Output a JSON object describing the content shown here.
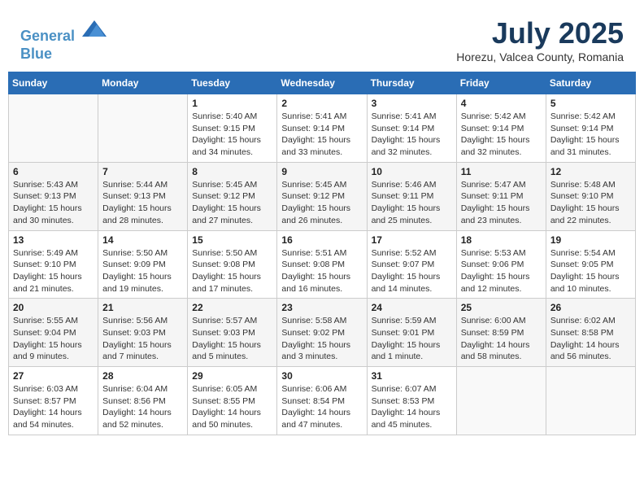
{
  "header": {
    "logo_line1": "General",
    "logo_line2": "Blue",
    "month_year": "July 2025",
    "location": "Horezu, Valcea County, Romania"
  },
  "weekdays": [
    "Sunday",
    "Monday",
    "Tuesday",
    "Wednesday",
    "Thursday",
    "Friday",
    "Saturday"
  ],
  "weeks": [
    [
      {
        "day": "",
        "info": ""
      },
      {
        "day": "",
        "info": ""
      },
      {
        "day": "1",
        "info": "Sunrise: 5:40 AM\nSunset: 9:15 PM\nDaylight: 15 hours\nand 34 minutes."
      },
      {
        "day": "2",
        "info": "Sunrise: 5:41 AM\nSunset: 9:14 PM\nDaylight: 15 hours\nand 33 minutes."
      },
      {
        "day": "3",
        "info": "Sunrise: 5:41 AM\nSunset: 9:14 PM\nDaylight: 15 hours\nand 32 minutes."
      },
      {
        "day": "4",
        "info": "Sunrise: 5:42 AM\nSunset: 9:14 PM\nDaylight: 15 hours\nand 32 minutes."
      },
      {
        "day": "5",
        "info": "Sunrise: 5:42 AM\nSunset: 9:14 PM\nDaylight: 15 hours\nand 31 minutes."
      }
    ],
    [
      {
        "day": "6",
        "info": "Sunrise: 5:43 AM\nSunset: 9:13 PM\nDaylight: 15 hours\nand 30 minutes."
      },
      {
        "day": "7",
        "info": "Sunrise: 5:44 AM\nSunset: 9:13 PM\nDaylight: 15 hours\nand 28 minutes."
      },
      {
        "day": "8",
        "info": "Sunrise: 5:45 AM\nSunset: 9:12 PM\nDaylight: 15 hours\nand 27 minutes."
      },
      {
        "day": "9",
        "info": "Sunrise: 5:45 AM\nSunset: 9:12 PM\nDaylight: 15 hours\nand 26 minutes."
      },
      {
        "day": "10",
        "info": "Sunrise: 5:46 AM\nSunset: 9:11 PM\nDaylight: 15 hours\nand 25 minutes."
      },
      {
        "day": "11",
        "info": "Sunrise: 5:47 AM\nSunset: 9:11 PM\nDaylight: 15 hours\nand 23 minutes."
      },
      {
        "day": "12",
        "info": "Sunrise: 5:48 AM\nSunset: 9:10 PM\nDaylight: 15 hours\nand 22 minutes."
      }
    ],
    [
      {
        "day": "13",
        "info": "Sunrise: 5:49 AM\nSunset: 9:10 PM\nDaylight: 15 hours\nand 21 minutes."
      },
      {
        "day": "14",
        "info": "Sunrise: 5:50 AM\nSunset: 9:09 PM\nDaylight: 15 hours\nand 19 minutes."
      },
      {
        "day": "15",
        "info": "Sunrise: 5:50 AM\nSunset: 9:08 PM\nDaylight: 15 hours\nand 17 minutes."
      },
      {
        "day": "16",
        "info": "Sunrise: 5:51 AM\nSunset: 9:08 PM\nDaylight: 15 hours\nand 16 minutes."
      },
      {
        "day": "17",
        "info": "Sunrise: 5:52 AM\nSunset: 9:07 PM\nDaylight: 15 hours\nand 14 minutes."
      },
      {
        "day": "18",
        "info": "Sunrise: 5:53 AM\nSunset: 9:06 PM\nDaylight: 15 hours\nand 12 minutes."
      },
      {
        "day": "19",
        "info": "Sunrise: 5:54 AM\nSunset: 9:05 PM\nDaylight: 15 hours\nand 10 minutes."
      }
    ],
    [
      {
        "day": "20",
        "info": "Sunrise: 5:55 AM\nSunset: 9:04 PM\nDaylight: 15 hours\nand 9 minutes."
      },
      {
        "day": "21",
        "info": "Sunrise: 5:56 AM\nSunset: 9:03 PM\nDaylight: 15 hours\nand 7 minutes."
      },
      {
        "day": "22",
        "info": "Sunrise: 5:57 AM\nSunset: 9:03 PM\nDaylight: 15 hours\nand 5 minutes."
      },
      {
        "day": "23",
        "info": "Sunrise: 5:58 AM\nSunset: 9:02 PM\nDaylight: 15 hours\nand 3 minutes."
      },
      {
        "day": "24",
        "info": "Sunrise: 5:59 AM\nSunset: 9:01 PM\nDaylight: 15 hours\nand 1 minute."
      },
      {
        "day": "25",
        "info": "Sunrise: 6:00 AM\nSunset: 8:59 PM\nDaylight: 14 hours\nand 58 minutes."
      },
      {
        "day": "26",
        "info": "Sunrise: 6:02 AM\nSunset: 8:58 PM\nDaylight: 14 hours\nand 56 minutes."
      }
    ],
    [
      {
        "day": "27",
        "info": "Sunrise: 6:03 AM\nSunset: 8:57 PM\nDaylight: 14 hours\nand 54 minutes."
      },
      {
        "day": "28",
        "info": "Sunrise: 6:04 AM\nSunset: 8:56 PM\nDaylight: 14 hours\nand 52 minutes."
      },
      {
        "day": "29",
        "info": "Sunrise: 6:05 AM\nSunset: 8:55 PM\nDaylight: 14 hours\nand 50 minutes."
      },
      {
        "day": "30",
        "info": "Sunrise: 6:06 AM\nSunset: 8:54 PM\nDaylight: 14 hours\nand 47 minutes."
      },
      {
        "day": "31",
        "info": "Sunrise: 6:07 AM\nSunset: 8:53 PM\nDaylight: 14 hours\nand 45 minutes."
      },
      {
        "day": "",
        "info": ""
      },
      {
        "day": "",
        "info": ""
      }
    ]
  ]
}
